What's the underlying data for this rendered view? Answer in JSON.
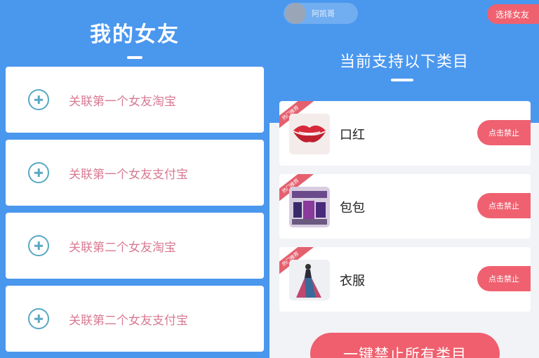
{
  "left": {
    "title": "我的女友",
    "cards": [
      {
        "label": "关联第一个女友淘宝"
      },
      {
        "label": "关联第一个女友支付宝"
      },
      {
        "label": "关联第二个女友淘宝"
      },
      {
        "label": "关联第二个女友支付宝"
      }
    ]
  },
  "right": {
    "user_name": "阿凯哥",
    "switch_label": "选择女友",
    "title": "当前支持以下类目",
    "categories": [
      {
        "name": "口红",
        "ribbon": "热门推荐",
        "button": "点击禁止"
      },
      {
        "name": "包包",
        "ribbon": "热门推荐",
        "button": "点击禁止"
      },
      {
        "name": "衣服",
        "ribbon": "热门推荐",
        "button": "点击禁止"
      }
    ],
    "forbid_all_label": "一键禁止所有类目"
  },
  "colors": {
    "primary_blue": "#4a97ee",
    "accent_red": "#ef5f6d",
    "link_text": "#d87a93",
    "plus_icon": "#5aa8c4"
  }
}
